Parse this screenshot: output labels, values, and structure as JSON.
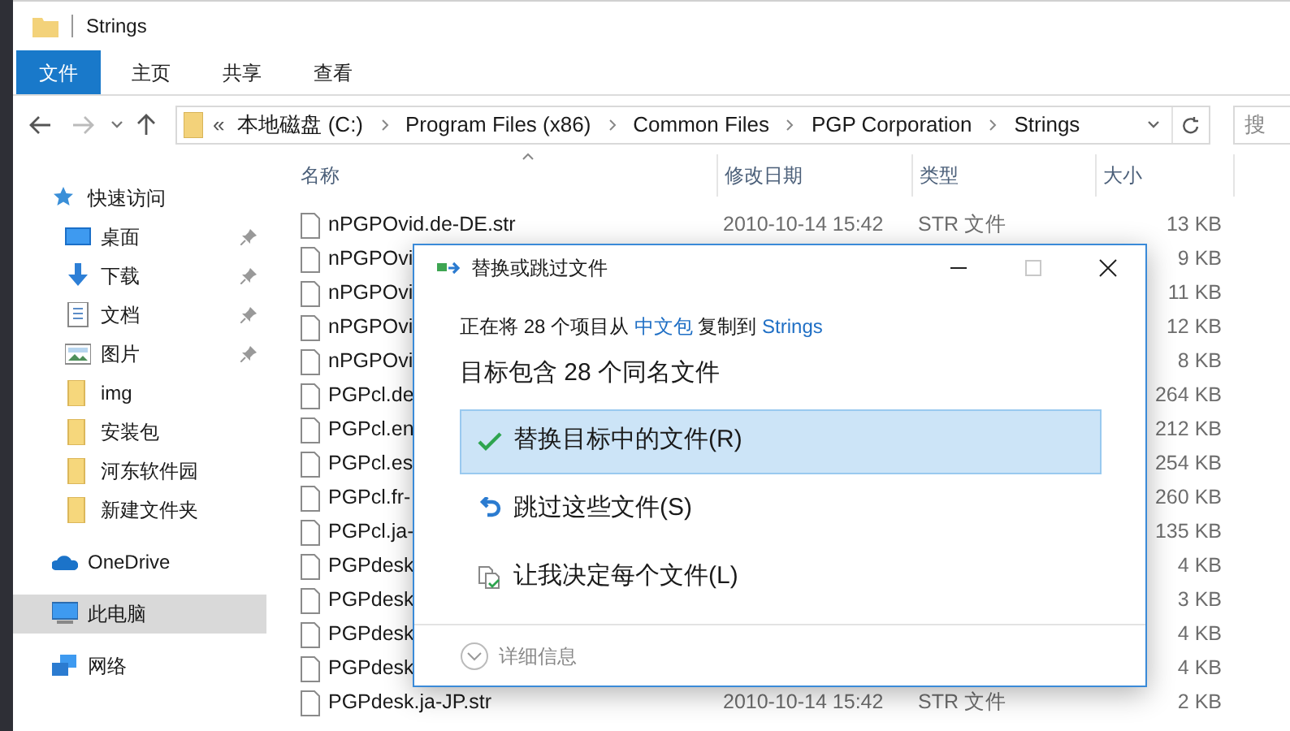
{
  "window": {
    "title": "Strings"
  },
  "ribbon_tabs": [
    {
      "label": "文件",
      "selected": true
    },
    {
      "label": "主页",
      "selected": false
    },
    {
      "label": "共享",
      "selected": false
    },
    {
      "label": "查看",
      "selected": false
    }
  ],
  "address_bar": {
    "overflow": "«",
    "path": [
      "本地磁盘 (C:)",
      "Program Files (x86)",
      "Common Files",
      "PGP Corporation",
      "Strings"
    ]
  },
  "search": {
    "placeholder": "搜"
  },
  "sidebar": {
    "items": [
      {
        "label": "快速访问",
        "kind": "quick",
        "pinned": false,
        "selected": false
      },
      {
        "label": "桌面",
        "kind": "desktop",
        "pinned": true,
        "selected": false
      },
      {
        "label": "下载",
        "kind": "download",
        "pinned": true,
        "selected": false
      },
      {
        "label": "文档",
        "kind": "document",
        "pinned": true,
        "selected": false
      },
      {
        "label": "图片",
        "kind": "pictures",
        "pinned": true,
        "selected": false
      },
      {
        "label": "img",
        "kind": "folder",
        "pinned": false,
        "selected": false
      },
      {
        "label": "安装包",
        "kind": "folder",
        "pinned": false,
        "selected": false
      },
      {
        "label": "河东软件园",
        "kind": "folder",
        "pinned": false,
        "selected": false
      },
      {
        "label": "新建文件夹",
        "kind": "folder",
        "pinned": false,
        "selected": false
      },
      {
        "label": "OneDrive",
        "kind": "cloud",
        "pinned": false,
        "selected": false
      },
      {
        "label": "此电脑",
        "kind": "computer",
        "pinned": false,
        "selected": true
      },
      {
        "label": "网络",
        "kind": "network",
        "pinned": false,
        "selected": false
      }
    ]
  },
  "file_list": {
    "columns": [
      "名称",
      "修改日期",
      "类型",
      "大小"
    ],
    "rows": [
      {
        "name": "nPGPOvid.de-DE.str",
        "date": "2010-10-14 15:42",
        "type": "STR 文件",
        "size": "13 KB"
      },
      {
        "name": "nPGPOvi",
        "size": "9 KB"
      },
      {
        "name": "nPGPOvi",
        "size": "11 KB"
      },
      {
        "name": "nPGPOvi",
        "size": "12 KB"
      },
      {
        "name": "nPGPOvi",
        "size": "8 KB"
      },
      {
        "name": "PGPcl.de",
        "size": "264 KB"
      },
      {
        "name": "PGPcl.en",
        "size": "212 KB"
      },
      {
        "name": "PGPcl.es",
        "size": "254 KB"
      },
      {
        "name": "PGPcl.fr-",
        "size": "260 KB"
      },
      {
        "name": "PGPcl.ja-",
        "size": "135 KB"
      },
      {
        "name": "PGPdesk",
        "size": "4 KB"
      },
      {
        "name": "PGPdesk",
        "size": "3 KB"
      },
      {
        "name": "PGPdesk",
        "size": "4 KB"
      },
      {
        "name": "PGPdesk",
        "size": "4 KB"
      },
      {
        "name": "PGPdesk.ja-JP.str",
        "date": "2010-10-14 15:42",
        "type": "STR 文件",
        "size": "2 KB"
      }
    ]
  },
  "dialog": {
    "title": "替换或跳过文件",
    "maximize_disabled": true,
    "message": {
      "prefix": "正在将 28 个项目从",
      "source": "中文包",
      "middle": "复制到",
      "destination": "Strings"
    },
    "heading": "目标包含 28 个同名文件",
    "options": [
      {
        "kind": "replace",
        "label": "替换目标中的文件(R)",
        "selected": true
      },
      {
        "kind": "skip",
        "label": "跳过这些文件(S)",
        "selected": false
      },
      {
        "kind": "decide",
        "label": "让我决定每个文件(L)",
        "selected": false
      }
    ],
    "details": {
      "label": "详细信息",
      "expanded": false
    }
  }
}
